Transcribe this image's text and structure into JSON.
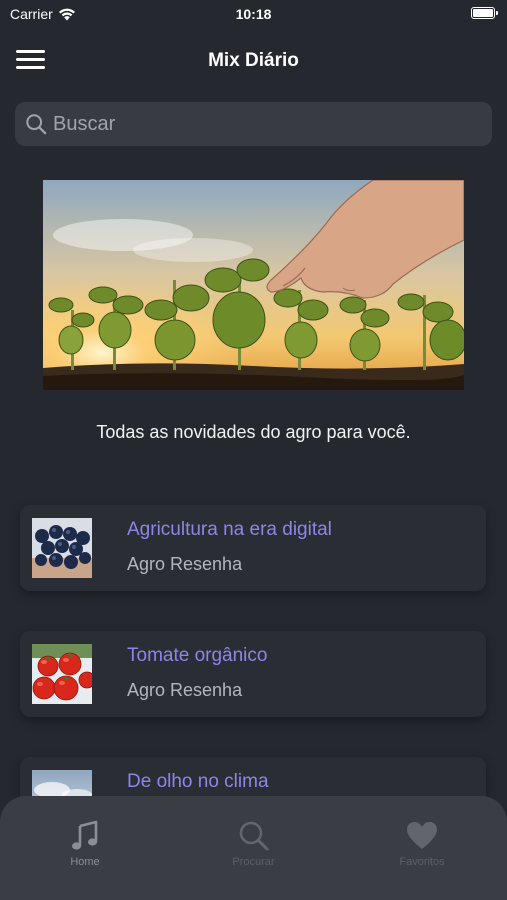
{
  "status_bar": {
    "carrier": "Carrier",
    "time": "10:18"
  },
  "nav": {
    "title": "Mix Diário"
  },
  "search": {
    "placeholder": "Buscar"
  },
  "hero": {
    "caption": "Todas as novidades do agro para você."
  },
  "news": [
    {
      "title": "Agricultura na era digital",
      "source": "Agro Resenha"
    },
    {
      "title": "Tomate orgânico",
      "source": "Agro Resenha"
    },
    {
      "title": "De olho no clima",
      "source": ""
    }
  ],
  "tabs": [
    {
      "label": "Home",
      "icon": "music-note-icon",
      "active": true
    },
    {
      "label": "Procurar",
      "icon": "search-icon",
      "active": false
    },
    {
      "label": "Favoritos",
      "icon": "heart-icon",
      "active": false
    }
  ],
  "colors": {
    "background": "#262830",
    "card": "#2b2d35",
    "accent_title": "#8b86e8",
    "tab_bar": "#3b3d45"
  }
}
